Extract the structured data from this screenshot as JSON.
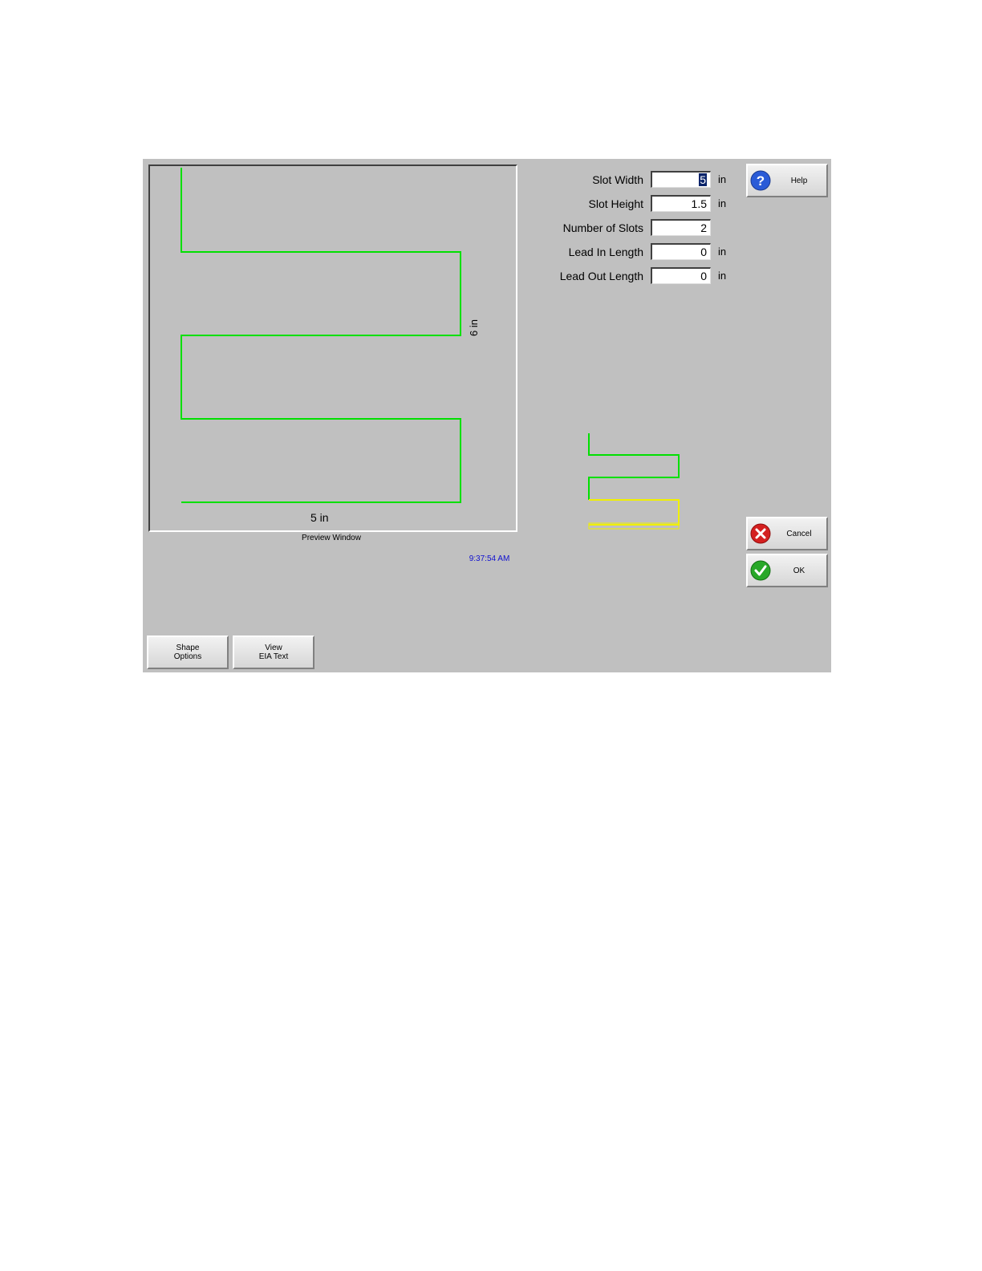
{
  "preview": {
    "width_label": "5 in",
    "height_label": "6 in",
    "caption": "Preview Window"
  },
  "clock": "9:37:54 AM",
  "fields": [
    {
      "label": "Slot Width",
      "value": "5",
      "unit": "in",
      "selected": true
    },
    {
      "label": "Slot Height",
      "value": "1.5",
      "unit": "in",
      "selected": false
    },
    {
      "label": "Number of Slots",
      "value": "2",
      "unit": "",
      "selected": false
    },
    {
      "label": "Lead In Length",
      "value": "0",
      "unit": "in",
      "selected": false
    },
    {
      "label": "Lead Out Length",
      "value": "0",
      "unit": "in",
      "selected": false
    }
  ],
  "buttons": {
    "help": "Help",
    "cancel": "Cancel",
    "ok": "OK",
    "shape_options": [
      "Shape",
      "Options"
    ],
    "view_eia": [
      "View",
      "EIA Text"
    ]
  },
  "colors": {
    "background": "#c0c0c0",
    "cut_path": "#00e000",
    "kerf_preview": "#f0f000",
    "clock_text": "#1010d0"
  },
  "icons": {
    "help": "question-icon",
    "cancel": "x-circle-icon",
    "ok": "checkmark-icon"
  }
}
